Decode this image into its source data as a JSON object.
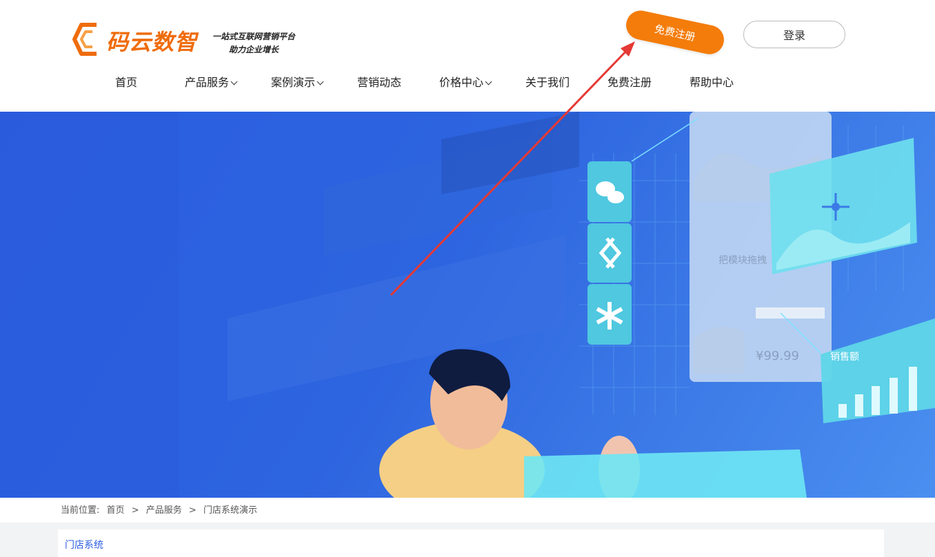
{
  "brand": {
    "name": "码云数智",
    "slogan_line1": "一站式互联网营销平台",
    "slogan_line2": "助力企业增长",
    "accent": "#ef6c0c"
  },
  "header": {
    "register_label": "免费注册",
    "login_label": "登录"
  },
  "nav": [
    {
      "label": "首页",
      "has_dropdown": false
    },
    {
      "label": "产品服务",
      "has_dropdown": true
    },
    {
      "label": "案例演示",
      "has_dropdown": true
    },
    {
      "label": "营销动态",
      "has_dropdown": false
    },
    {
      "label": "价格中心",
      "has_dropdown": true
    },
    {
      "label": "关于我们",
      "has_dropdown": false
    },
    {
      "label": "免费注册",
      "has_dropdown": false
    },
    {
      "label": "帮助中心",
      "has_dropdown": false
    }
  ],
  "hero": {
    "card_text": "把模块拖拽",
    "price_text": "¥99.99",
    "chart_label": "销售额",
    "colors": {
      "bg": "#2d64df",
      "panel": "#5fd6e8"
    }
  },
  "breadcrumb": {
    "prefix": "当前位置:",
    "items": [
      "首页",
      "产品服务",
      "门店系统演示"
    ],
    "separator": ">"
  },
  "content": {
    "title": "门店系统"
  }
}
